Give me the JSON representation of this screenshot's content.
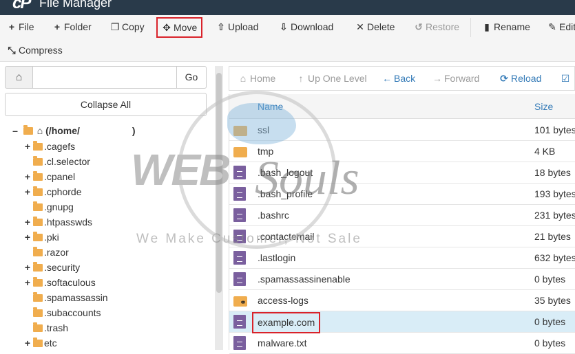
{
  "app": {
    "title": "File Manager",
    "logo": "cP"
  },
  "toolbar": {
    "file": "File",
    "folder": "Folder",
    "copy": "Copy",
    "move": "Move",
    "upload": "Upload",
    "download": "Download",
    "delete": "Delete",
    "restore": "Restore",
    "rename": "Rename",
    "edit": "Edit",
    "compress": "Compress"
  },
  "left": {
    "go_label": "Go",
    "path_value": "",
    "collapse_label": "Collapse All",
    "root_label": "(/home/",
    "root_suffix": ")",
    "tree": [
      {
        "name": ".cagefs",
        "expandable": true
      },
      {
        "name": ".cl.selector",
        "expandable": false
      },
      {
        "name": ".cpanel",
        "expandable": true
      },
      {
        "name": ".cphorde",
        "expandable": true
      },
      {
        "name": ".gnupg",
        "expandable": false
      },
      {
        "name": ".htpasswds",
        "expandable": true
      },
      {
        "name": ".pki",
        "expandable": true
      },
      {
        "name": ".razor",
        "expandable": false
      },
      {
        "name": ".security",
        "expandable": true
      },
      {
        "name": ".softaculous",
        "expandable": true
      },
      {
        "name": ".spamassassin",
        "expandable": false
      },
      {
        "name": ".subaccounts",
        "expandable": false
      },
      {
        "name": ".trash",
        "expandable": false
      },
      {
        "name": "etc",
        "expandable": true
      }
    ]
  },
  "nav": {
    "home": "Home",
    "up": "Up One Level",
    "back": "Back",
    "forward": "Forward",
    "reload": "Reload"
  },
  "table": {
    "col_name": "Name",
    "col_size": "Size",
    "rows": [
      {
        "name": "ssl",
        "size": "101 bytes",
        "type": "folder"
      },
      {
        "name": "tmp",
        "size": "4 KB",
        "type": "folder"
      },
      {
        "name": ".bash_logout",
        "size": "18 bytes",
        "type": "file"
      },
      {
        "name": ".bash_profile",
        "size": "193 bytes",
        "type": "file"
      },
      {
        "name": ".bashrc",
        "size": "231 bytes",
        "type": "file"
      },
      {
        "name": ".contactemail",
        "size": "21 bytes",
        "type": "file"
      },
      {
        "name": ".lastlogin",
        "size": "632 bytes",
        "type": "file"
      },
      {
        "name": ".spamassassinenable",
        "size": "0 bytes",
        "type": "file"
      },
      {
        "name": "access-logs",
        "size": "35 bytes",
        "type": "link"
      },
      {
        "name": "example.com",
        "size": "0 bytes",
        "type": "file",
        "selected": true
      },
      {
        "name": "malware.txt",
        "size": "0 bytes",
        "type": "file"
      }
    ]
  },
  "watermark": {
    "brand_a": "WEB",
    "brand_b": "Souls",
    "tagline": "We Make Customer, Not Sale"
  },
  "colors": {
    "header_bg": "#293a4a",
    "link": "#337ab7",
    "highlight_border": "#d9222a",
    "selected_row": "#d9edf7",
    "folder": "#f0ad4e",
    "file": "#7a5f9e"
  }
}
